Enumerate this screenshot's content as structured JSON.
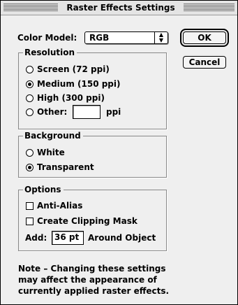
{
  "window": {
    "title": "Raster Effects Settings"
  },
  "color_model": {
    "label": "Color Model:",
    "value": "RGB"
  },
  "buttons": {
    "ok": "OK",
    "cancel": "Cancel"
  },
  "resolution": {
    "legend": "Resolution",
    "options": [
      {
        "label": "Screen (72 ppi)",
        "selected": false
      },
      {
        "label": "Medium (150 ppi)",
        "selected": true
      },
      {
        "label": "High (300 ppi)",
        "selected": false
      },
      {
        "label": "Other:",
        "selected": false
      }
    ],
    "other_value": "",
    "other_unit": "ppi"
  },
  "background": {
    "legend": "Background",
    "options": [
      {
        "label": "White",
        "selected": false
      },
      {
        "label": "Transparent",
        "selected": true
      }
    ]
  },
  "options": {
    "legend": "Options",
    "anti_alias": {
      "label": "Anti-Alias",
      "checked": false
    },
    "clipping_mask": {
      "label": "Create Clipping Mask",
      "checked": false
    },
    "add_label": "Add:",
    "add_value": "36 pt",
    "add_suffix": "Around Object"
  },
  "note": {
    "lines": [
      "Note – Changing these settings",
      "may affect the appearance of",
      "currently applied raster effects."
    ]
  }
}
